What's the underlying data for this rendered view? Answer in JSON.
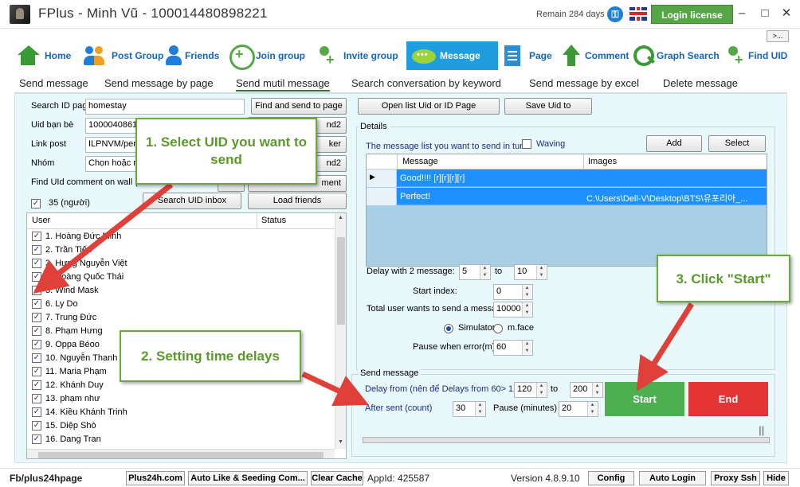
{
  "window": {
    "title": "FPlus - Minh Vũ - 100014480898221",
    "remain": "Remain 284 days",
    "login_label": "Login license",
    "minimize": "–",
    "maximize": "□",
    "close": "✕",
    "more": ">..."
  },
  "nav": [
    {
      "label": "Home",
      "icon": "home-icon"
    },
    {
      "label": "Post Group",
      "icon": "group-icon"
    },
    {
      "label": "Friends",
      "icon": "friends-icon"
    },
    {
      "label": "Join group",
      "icon": "join-group-icon"
    },
    {
      "label": "Invite group",
      "icon": "invite-icon"
    },
    {
      "label": "Message",
      "icon": "message-icon"
    },
    {
      "label": "Page",
      "icon": "page-icon"
    },
    {
      "label": "Comment",
      "icon": "comment-icon"
    },
    {
      "label": "Graph Search",
      "icon": "search-icon"
    },
    {
      "label": "Find UID",
      "icon": "find-uid-icon"
    }
  ],
  "subtabs": [
    "Send message",
    "Send message by page",
    "Send mutil message",
    "Search conversation by keyword",
    "Send message by excel",
    "Delete message"
  ],
  "left": {
    "search_id_label": "Search ID pag",
    "search_id_value": "homestay",
    "find_send_btn": "Find and send to page",
    "uid_label": "Uid bạn bè",
    "uid_value": "1000040861",
    "uid_btn": "nd2",
    "link_label": "Link post",
    "link_value": "ILPNVM/per",
    "link_btn": "ker",
    "nhom_label": "Nhóm",
    "nhom_value": "Chọn hoặc n",
    "nhom_btn": "nd2",
    "find_uid_label": "Find UId comment on wall (c",
    "comment_btn": "ment",
    "count_label": "35 (người)",
    "search_inbox_btn": "Search UID inbox",
    "load_friends_btn": "Load friends",
    "col_user": "User",
    "col_status": "Status",
    "users": [
      "1. Hoàng Đức Minh",
      "2. Trần Tiến",
      "3. Hưng Nguyễn Việt",
      "4. Hoàng Quốc Thái",
      "5. Wind Mask",
      "6. Ly Do",
      "7. Trung Đức",
      "8. Phạm Hưng",
      "9. Oppa Béoo",
      "10. Nguyễn Thanh",
      "11. Maria Phạm",
      "12. Khánh Duy",
      "13. phạm như",
      "14. Kiều Khánh Trinh",
      "15. Diệp Shò",
      "16. Dang Tran"
    ]
  },
  "right": {
    "open_list_btn": "Open list Uid or ID Page",
    "save_uid_btn": "Save Uid to",
    "details_title": "Details",
    "msg_list_label": "The message list you want to send in turn",
    "waving_label": "Waving",
    "add_btn": "Add",
    "select_btn": "Select",
    "col_message": "Message",
    "col_images": "Images",
    "rows": [
      {
        "message": "Good!!!! [r][r][r][r]",
        "images": ""
      },
      {
        "message": "Perfect!",
        "images": "C:\\Users\\Dell-V\\Desktop\\BTS\\유포리아_..."
      }
    ],
    "delay_label": "Delay with 2 message:",
    "delay_from": "5",
    "to_label": "to",
    "delay_to": "10",
    "start_index_label": "Start index:",
    "start_index": "0",
    "total_label": "Total user wants to send a messa",
    "total_value": "10000",
    "simulator_label": "Simulator",
    "mface_label": "m.face",
    "pause_error_label": "Pause when error(m)",
    "pause_error_value": "60",
    "send_title": "Send message",
    "delay_from_label": "Delay from (nên để Delays from 60> 12(",
    "sm_delay_from": "120",
    "sm_to_label": "to",
    "sm_delay_to": "200",
    "after_sent_label": "After sent (count)",
    "after_sent_value": "30",
    "pause_minutes_label": "Pause (minutes)",
    "pause_minutes_value": "20",
    "start_btn": "Start",
    "end_btn": "End",
    "pause_glyph": "||"
  },
  "status": {
    "fb": "Fb/plus24hpage",
    "plus24h": "Plus24h.com",
    "auto_like": "Auto Like & Seeding Com...",
    "clear_cache": "Clear Cache",
    "appid": "AppId: 425587",
    "version": "Version 4.8.9.10",
    "config": "Config",
    "auto_login": "Auto Login",
    "proxy": "Proxy Ssh",
    "hide": "Hide"
  },
  "callouts": {
    "step1": "1. Select UID you want to send",
    "step2": "2. Setting time delays",
    "step3": "3. Click \"Start\""
  },
  "colors": {
    "accent": "#1e9de0",
    "start": "#4caf50",
    "end": "#e33535",
    "callout": "#6aaa3a",
    "arrow": "#e0403a"
  }
}
